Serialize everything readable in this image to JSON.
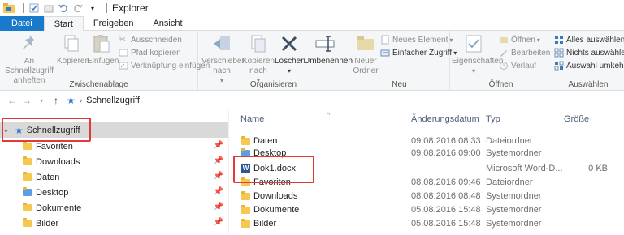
{
  "window": {
    "title": "Explorer"
  },
  "ribbon_tabs": [
    "Datei",
    "Start",
    "Freigeben",
    "Ansicht"
  ],
  "ribbon": {
    "zwischenablage": {
      "label": "Zwischenablage",
      "pin": "An Schnellzugriff anheften",
      "copy": "Kopieren",
      "paste": "Einfügen",
      "cut": "Ausschneiden",
      "copy_path": "Pfad kopieren",
      "paste_shortcut": "Verknüpfung einfügen"
    },
    "organisieren": {
      "label": "Organisieren",
      "move": "Verschieben nach",
      "copyto": "Kopieren nach",
      "delete": "Löschen",
      "rename": "Umbenennen"
    },
    "neu": {
      "label": "Neu",
      "new_folder": "Neuer Ordner",
      "new_item": "Neues Element",
      "easy_access": "Einfacher Zugriff"
    },
    "oeffnen": {
      "label": "Öffnen",
      "properties": "Eigenschaften",
      "open": "Öffnen",
      "edit": "Bearbeiten",
      "history": "Verlauf"
    },
    "auswaehlen": {
      "label": "Auswählen",
      "select_all": "Alles auswählen",
      "select_none": "Nichts auswählen",
      "invert": "Auswahl umkehren"
    }
  },
  "address": {
    "crumb": "Schnellzugriff"
  },
  "nav": {
    "items": [
      {
        "label": "Schnellzugriff",
        "icon": "star-icon"
      },
      {
        "label": "Favoriten",
        "icon": "folder-icon"
      },
      {
        "label": "Downloads",
        "icon": "downloads-icon"
      },
      {
        "label": "Daten",
        "icon": "folder-icon"
      },
      {
        "label": "Desktop",
        "icon": "desktop-icon"
      },
      {
        "label": "Dokumente",
        "icon": "documents-icon"
      },
      {
        "label": "Bilder",
        "icon": "pictures-icon"
      }
    ]
  },
  "columns": {
    "name": "Name",
    "date": "Änderungsdatum",
    "type": "Typ",
    "size": "Größe"
  },
  "files": [
    {
      "name": "Daten",
      "date": "09.08.2016 08:33",
      "type": "Dateiordner",
      "size": ""
    },
    {
      "name": "Desktop",
      "date": "09.08.2016 09:00",
      "type": "Systemordner",
      "size": ""
    },
    {
      "name": "Dok1.docx",
      "date": "",
      "type": "Microsoft Word-D...",
      "size": "0 KB"
    },
    {
      "name": "Favoriten",
      "date": "08.08.2016 09:46",
      "type": "Dateiordner",
      "size": ""
    },
    {
      "name": "Downloads",
      "date": "08.08.2016 08:48",
      "type": "Systemordner",
      "size": ""
    },
    {
      "name": "Dokumente",
      "date": "05.08.2016 15:48",
      "type": "Systemordner",
      "size": ""
    },
    {
      "name": "Bilder",
      "date": "05.08.2016 15:48",
      "type": "Systemordner",
      "size": ""
    }
  ],
  "colors": {
    "accent": "#1979ca",
    "highlight": "#e53935"
  }
}
